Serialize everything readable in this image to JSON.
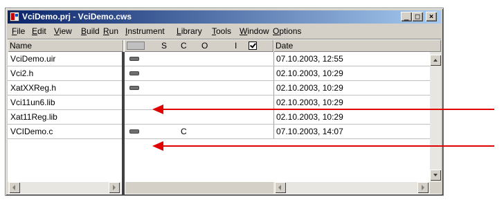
{
  "window": {
    "title": "VciDemo.prj - VciDemo.cws"
  },
  "menu": [
    "File",
    "Edit",
    "View",
    "Build",
    "Run",
    "Instrument",
    "Library",
    "Tools",
    "Window",
    "Options"
  ],
  "columns": {
    "name": "Name",
    "flags": [
      "S",
      "C",
      "O",
      "I"
    ],
    "date": "Date"
  },
  "files": [
    {
      "name": "VciDemo.uir",
      "date": "07.10.2003, 12:55",
      "bar": true,
      "letter": ""
    },
    {
      "name": "Vci2.h",
      "date": "02.10.2003, 10:29",
      "bar": true,
      "letter": ""
    },
    {
      "name": "XatXXReg.h",
      "date": "02.10.2003, 10:29",
      "bar": true,
      "letter": ""
    },
    {
      "name": "Vci11un6.lib",
      "date": "02.10.2003, 10:29",
      "bar": false,
      "letter": ""
    },
    {
      "name": "Xat11Reg.lib",
      "date": "02.10.2003, 10:29",
      "bar": false,
      "letter": ""
    },
    {
      "name": "VCIDemo.c",
      "date": "07.10.2003, 14:07",
      "bar": true,
      "letter": "C"
    }
  ],
  "colors": {
    "title_start": "#0a246a",
    "title_end": "#a6caf0",
    "annotation_arrow": "#e00000"
  },
  "icons": [
    "app-icon",
    "minimize-icon",
    "maximize-icon",
    "close-icon",
    "checkbox-icon",
    "scroll-up-icon",
    "scroll-down-icon",
    "scroll-left-icon",
    "scroll-right-icon"
  ]
}
